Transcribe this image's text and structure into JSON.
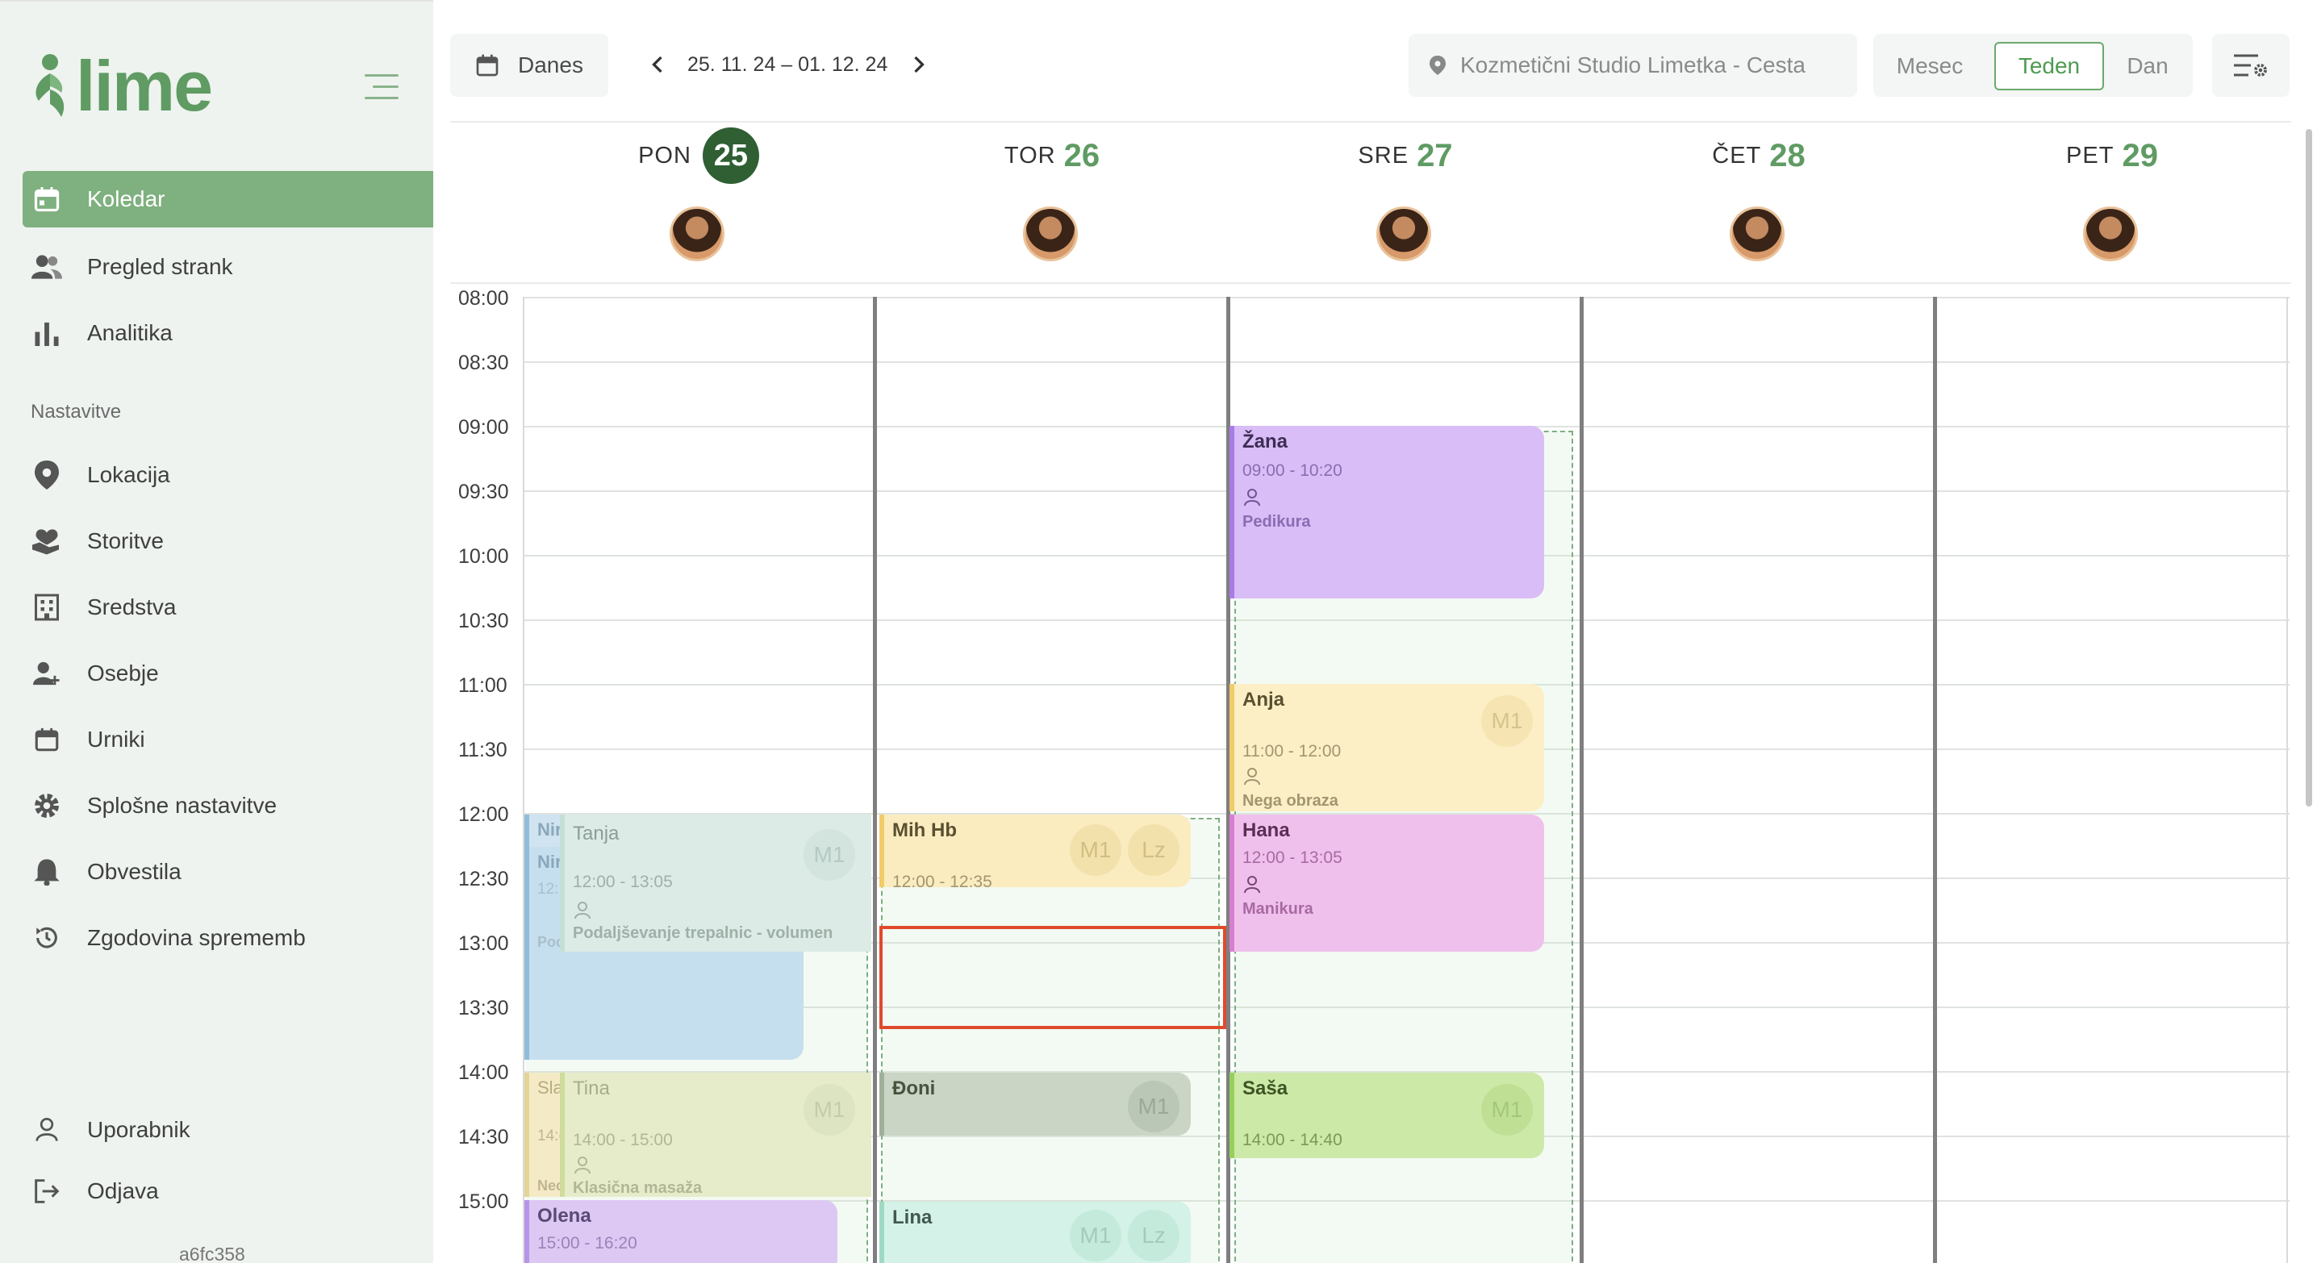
{
  "sidebar": {
    "brand": "lime",
    "items": [
      {
        "label": "Koledar",
        "icon": "calendar-icon"
      },
      {
        "label": "Pregled strank",
        "icon": "users-icon"
      },
      {
        "label": "Analitika",
        "icon": "bar-chart-icon"
      }
    ],
    "section_label": "Nastavitve",
    "settings_items": [
      {
        "label": "Lokacija",
        "icon": "location-pin-icon"
      },
      {
        "label": "Storitve",
        "icon": "hand-heart-icon"
      },
      {
        "label": "Sredstva",
        "icon": "building-icon"
      },
      {
        "label": "Osebje",
        "icon": "add-person-icon"
      },
      {
        "label": "Urniki",
        "icon": "calendar-icon"
      },
      {
        "label": "Splošne nastavitve",
        "icon": "gear-icon"
      },
      {
        "label": "Obvestila",
        "icon": "bell-icon"
      },
      {
        "label": "Zgodovina sprememb",
        "icon": "history-icon"
      }
    ],
    "bottom_items": [
      {
        "label": "Uporabnik",
        "icon": "user-icon"
      },
      {
        "label": "Odjava",
        "icon": "logout-icon"
      }
    ],
    "version": "a6fc358"
  },
  "toolbar": {
    "today_label": "Danes",
    "date_range": "25. 11. 24 – 01. 12. 24",
    "location": "Kozmetični Studio Limetka - Cesta",
    "views": [
      "Mesec",
      "Teden",
      "Dan"
    ],
    "selected_view": "Teden"
  },
  "days": [
    {
      "name": "PON",
      "num": "25",
      "today": true
    },
    {
      "name": "TOR",
      "num": "26",
      "today": false
    },
    {
      "name": "SRE",
      "num": "27",
      "today": false
    },
    {
      "name": "ČET",
      "num": "28",
      "today": false
    },
    {
      "name": "PET",
      "num": "29",
      "today": false
    }
  ],
  "times": [
    "08:00",
    "08:30",
    "09:00",
    "09:30",
    "10:00",
    "10:30",
    "11:00",
    "11:30",
    "12:00",
    "12:30",
    "13:00",
    "13:30",
    "14:00",
    "14:30",
    "15:00"
  ],
  "events": {
    "mon_nin_a": {
      "title": "Nir"
    },
    "mon_nin_b": {
      "title": "Nir",
      "time": "12:",
      "service": "Poc"
    },
    "mon_tanja": {
      "title": "Tanja",
      "time": "12:00 - 13:05",
      "service": "Podaljševanje trepalnic - volumen",
      "badge": "M1"
    },
    "mon_sla": {
      "title": "Sla",
      "time": "14:(",
      "service": "Nec"
    },
    "mon_tina": {
      "title": "Tina",
      "time": "14:00 - 15:00",
      "service": "Klasična masaža",
      "badge": "M1"
    },
    "mon_olena": {
      "title": "Olena",
      "time": "15:00 - 16:20"
    },
    "tue_mih": {
      "title": "Mih Hb",
      "time": "12:00 - 12:35",
      "badges": [
        "M1",
        "Lz"
      ]
    },
    "tue_doni": {
      "title": "Đoni",
      "badge": "M1"
    },
    "tue_lina": {
      "title": "Lina",
      "badges": [
        "M1",
        "Lz"
      ]
    },
    "wed_zana": {
      "title": "Žana",
      "time": "09:00 - 10:20",
      "service": "Pedikura"
    },
    "wed_anja": {
      "title": "Anja",
      "time": "11:00 - 12:00",
      "service": "Nega obraza",
      "badge": "M1"
    },
    "wed_hana": {
      "title": "Hana",
      "time": "12:00 - 13:05",
      "service": "Manikura"
    },
    "wed_sasa": {
      "title": "Saša",
      "time": "14:00 - 14:40",
      "badge": "M1"
    }
  },
  "colors": {
    "accent": "#5f9b63",
    "active_nav": "#7fb07f",
    "today_circle": "#2f5f33",
    "selection": "#e04a2c"
  }
}
